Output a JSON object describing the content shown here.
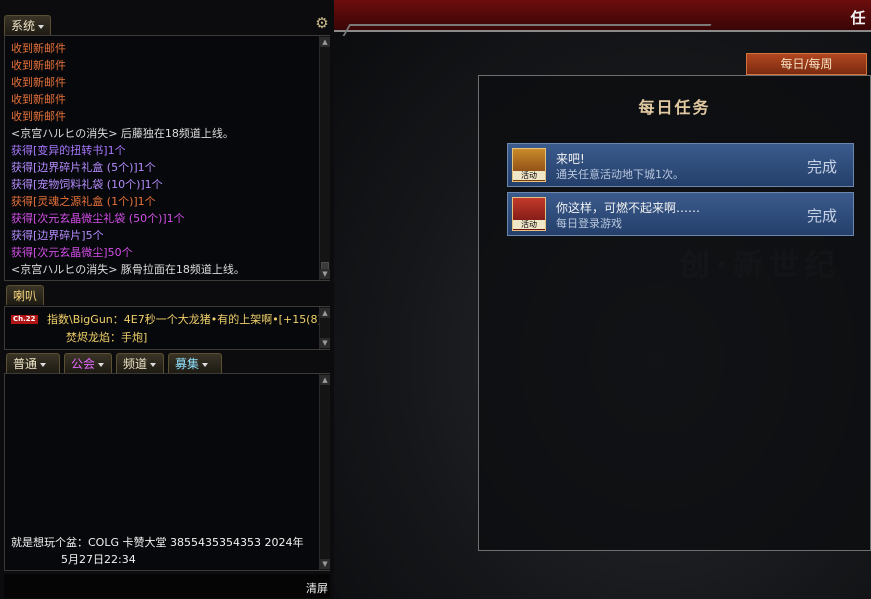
{
  "system": {
    "tab_label": "系统",
    "messages": [
      {
        "text": "收到新邮件",
        "color": "#e8723a"
      },
      {
        "text": "收到新邮件",
        "color": "#e8723a"
      },
      {
        "text": "收到新邮件",
        "color": "#e8723a"
      },
      {
        "text": "收到新邮件",
        "color": "#e8723a"
      },
      {
        "text": "收到新邮件",
        "color": "#e8723a"
      },
      {
        "text": "<京宫ハルヒの消失> 后藤独在18频道上线。",
        "color": "#dcdcdc"
      },
      {
        "text": "获得[变异的扭转书]1个",
        "color": "#a878ff"
      },
      {
        "text": "获得[边界碎片礼盒 (5个)]1个",
        "color": "#b48cff"
      },
      {
        "text": "获得[宠物饲料礼袋 (10个)]1个",
        "color": "#b48cff"
      },
      {
        "text": "获得[灵魂之源礼盒 (1个)]1个",
        "color": "#e8723a"
      },
      {
        "text": "获得[次元玄晶微尘礼袋 (50个)]1个",
        "color": "#d34ee8"
      },
      {
        "text": "获得[边界碎片]5个",
        "color": "#b48cff"
      },
      {
        "text": "获得[次元玄晶微尘]50个",
        "color": "#d34ee8"
      },
      {
        "text": "<京宫ハルヒの消失> 豚骨拉面在18频道上线。",
        "color": "#dcdcdc"
      }
    ]
  },
  "horn": {
    "tab_label": "喇叭",
    "channel_badge": "Ch.22",
    "line1": "指数\\BigGun：4E7秒一个大龙猪•有的上架啊•[+15(8)",
    "line2": "焚烬龙焰：手炮]"
  },
  "chat": {
    "tabs": [
      {
        "label": "普通",
        "color": "#f2f2f2"
      },
      {
        "label": "公会",
        "color": "#e368ff"
      },
      {
        "label": "频道",
        "color": "#f2f2f2"
      },
      {
        "label": "募集",
        "color": "#8fe0ff"
      }
    ],
    "line1": "就是想玩个盆：COLG  卡赞大堂  3855435354353  2024年",
    "line2": "5月27日22:34",
    "clear_label": "清屏"
  },
  "quest": {
    "top_tab": "任",
    "period_tab": "每日/每周",
    "title": "每日任务",
    "items": [
      {
        "name": "来吧!",
        "desc": "通关任意活动地下城1次。",
        "button": "完成",
        "icon": "event-icon"
      },
      {
        "name": "你这样，可燃不起来啊……",
        "desc": "每日登录游戏",
        "button": "完成",
        "icon": "event-icon"
      }
    ],
    "icon_label": "活动"
  },
  "colors": {
    "accent_red": "#6d0d0d",
    "quest_item_blue": "#3b5b8d",
    "tab_orange": "#b1471f"
  }
}
